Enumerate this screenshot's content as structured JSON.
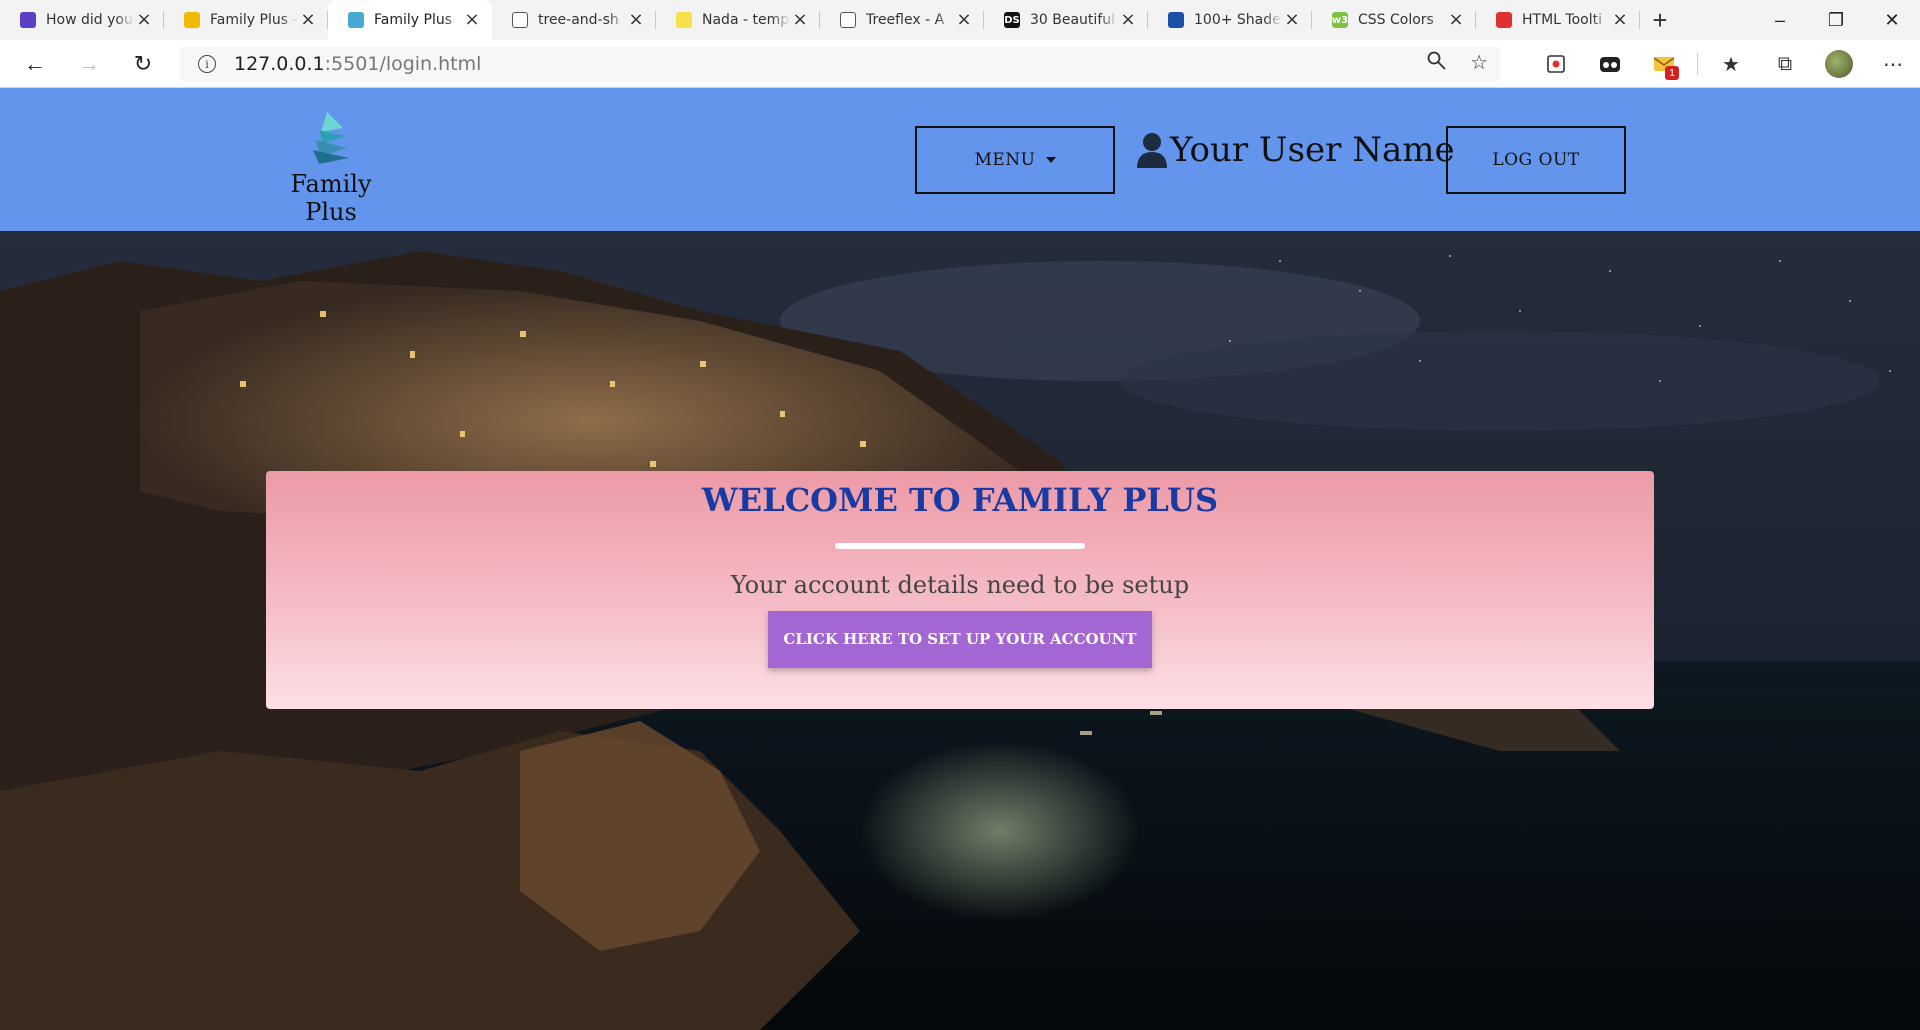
{
  "browser": {
    "tabs": [
      {
        "title": "How did you",
        "favicon_color": "#5b3fc4",
        "active": false
      },
      {
        "title": "Family Plus -",
        "favicon_color": "#f0b800",
        "active": false
      },
      {
        "title": "Family Plus",
        "favicon_color": "#49a7d6",
        "active": true
      },
      {
        "title": "tree-and-sh",
        "favicon_color": "#ffffff",
        "active": false
      },
      {
        "title": "Nada - temp",
        "favicon_color": "#f7e04a",
        "active": false
      },
      {
        "title": "Treeflex - A",
        "favicon_color": "#ffffff",
        "active": false
      },
      {
        "title": "30 Beautiful",
        "favicon_color": "#111111",
        "favicon_text": "DS",
        "active": false
      },
      {
        "title": "100+ Shade",
        "favicon_color": "#1c4fa8",
        "active": false
      },
      {
        "title": "CSS Colors",
        "favicon_color": "#7cc143",
        "favicon_text": "w3",
        "active": false
      },
      {
        "title": "HTML Toolti",
        "favicon_color": "#e03131",
        "active": false
      }
    ],
    "new_tab_label": "+",
    "url_host": "127.0.0.1",
    "url_rest": ":5501/login.html",
    "notification_count": "1"
  },
  "header": {
    "brand_name": "Family Plus",
    "menu_label": "MENU",
    "user_name": "Your User Name",
    "logout_label": "LOG OUT",
    "background_color": "#6495ed"
  },
  "welcome": {
    "title": "WELCOME TO FAMILY PLUS",
    "subtitle": "Your account details need to be setup",
    "button_label": "CLICK HERE TO SET UP YOUR ACCOUNT",
    "title_color": "#1a3aa3",
    "button_color": "#a466d2"
  },
  "icons": {
    "back": "arrow-left-icon",
    "forward": "arrow-right-icon",
    "refresh": "refresh-icon",
    "info": "info-icon",
    "search": "search-key-icon",
    "favorite": "star-icon",
    "user": "user-icon",
    "menu_caret": "caret-down-icon"
  }
}
